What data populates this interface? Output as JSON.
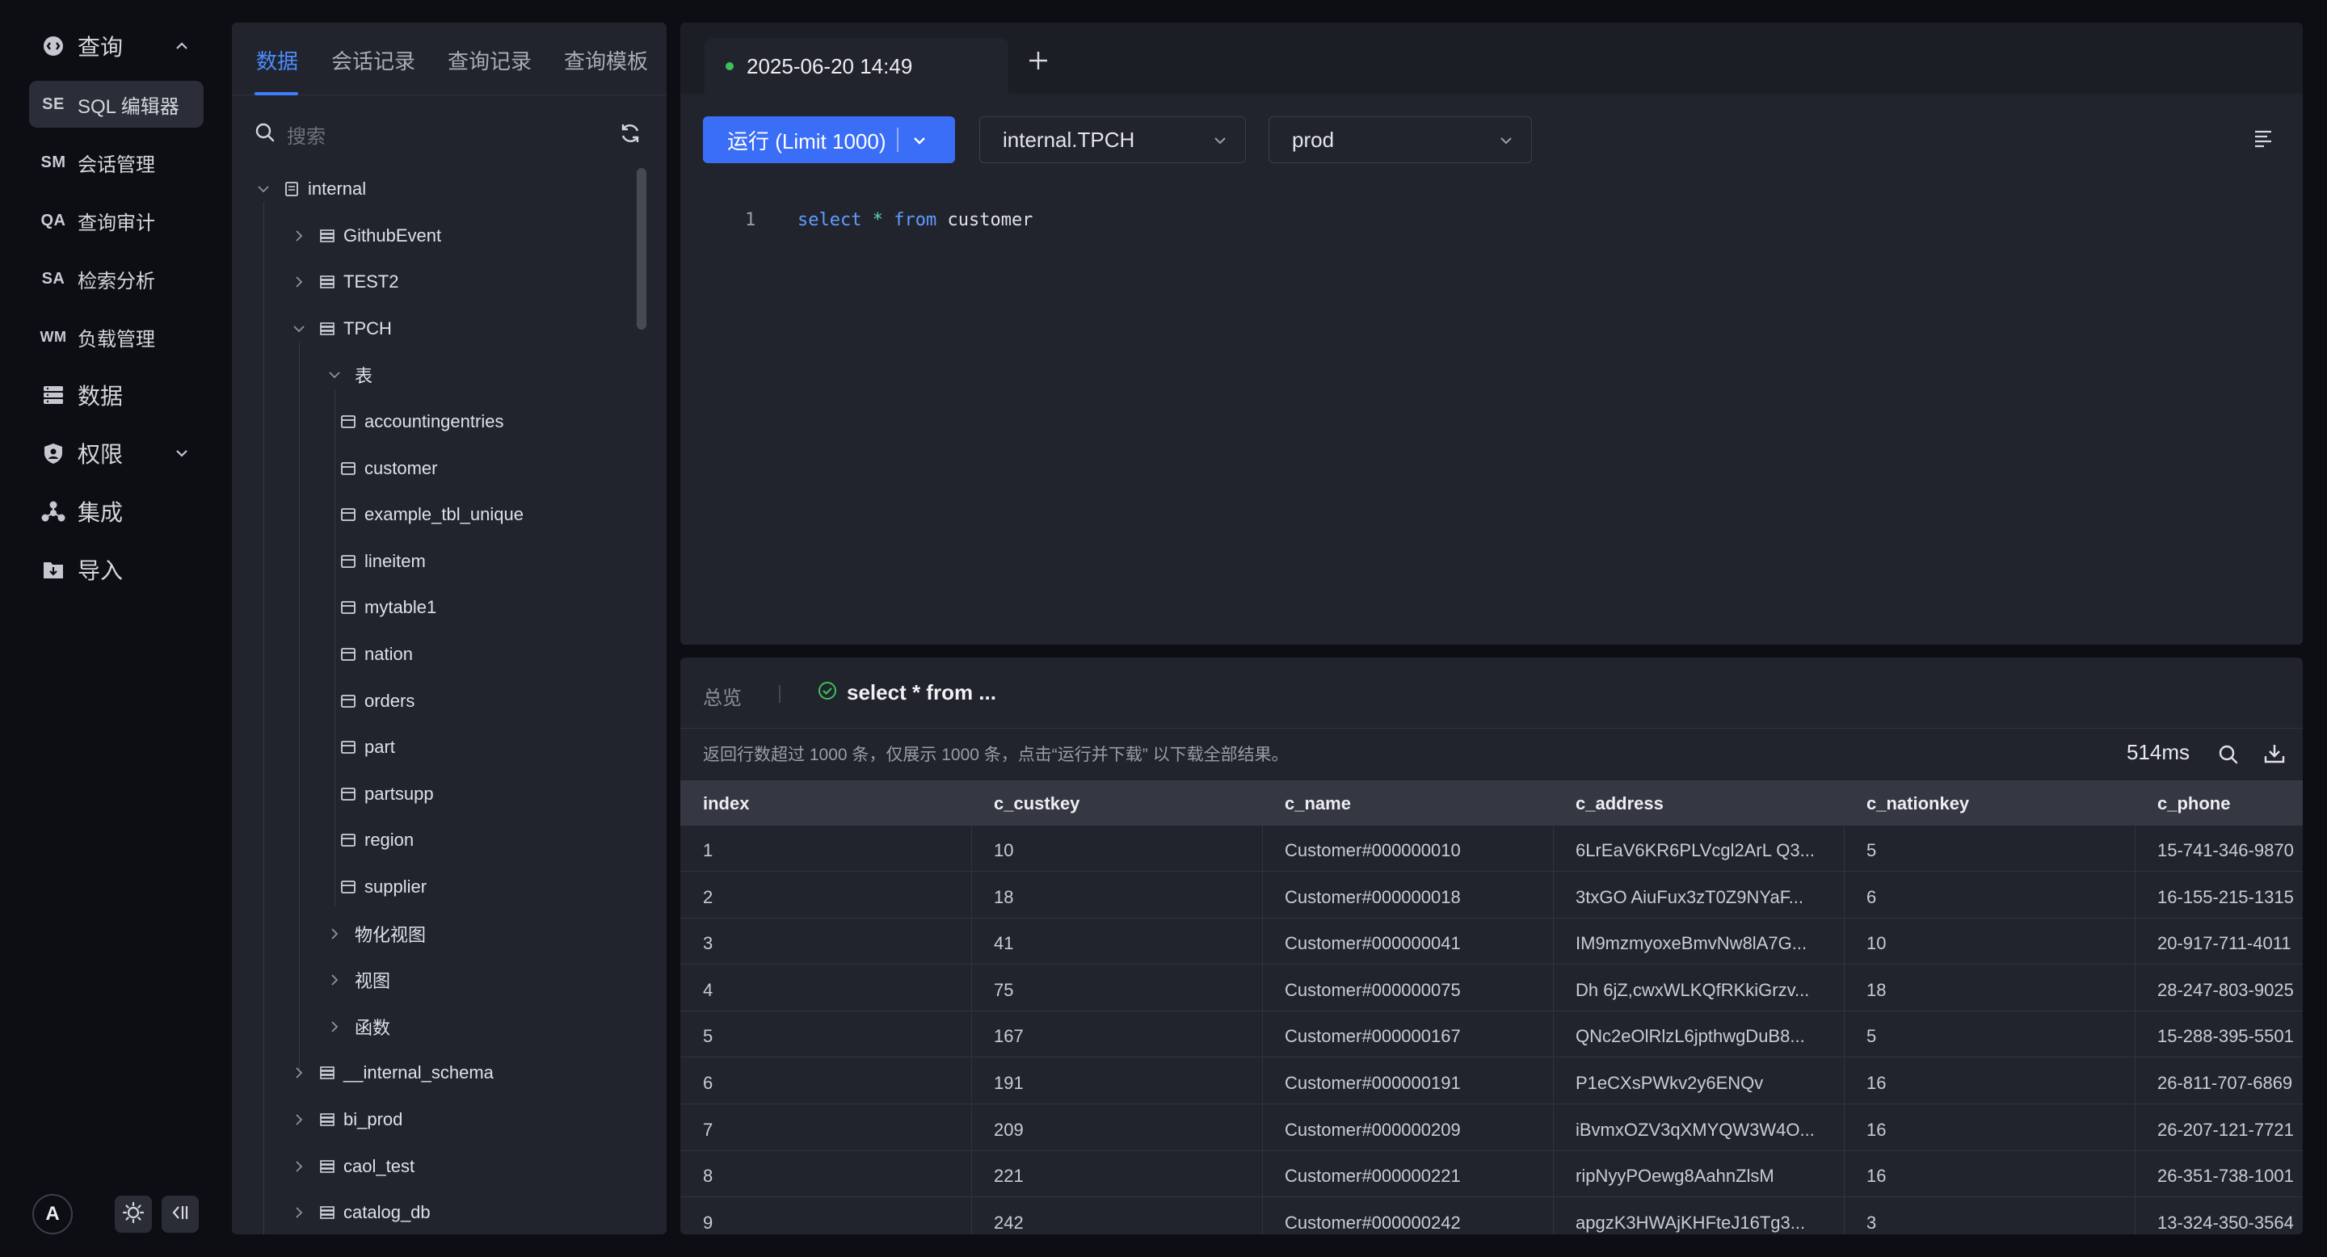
{
  "nav": {
    "query_label": "查询",
    "items": [
      {
        "abbr": "SE",
        "label": "SQL 编辑器"
      },
      {
        "abbr": "SM",
        "label": "会话管理"
      },
      {
        "abbr": "QA",
        "label": "查询审计"
      },
      {
        "abbr": "SA",
        "label": "检索分析"
      },
      {
        "abbr": "WM",
        "label": "负载管理"
      }
    ],
    "data_label": "数据",
    "permission_label": "权限",
    "integration_label": "集成",
    "import_label": "导入",
    "avatar_letter": "A"
  },
  "panel": {
    "tabs": [
      "数据",
      "会话记录",
      "查询记录",
      "查询模板"
    ],
    "search_placeholder": "搜索",
    "tree": {
      "root": "internal",
      "databases_top": [
        "GithubEvent",
        "TEST2"
      ],
      "open_db": "TPCH",
      "tables_folder": "表",
      "tables": [
        "accountingentries",
        "customer",
        "example_tbl_unique",
        "lineitem",
        "mytable1",
        "nation",
        "orders",
        "part",
        "partsupp",
        "region",
        "supplier"
      ],
      "folders": [
        "物化视图",
        "视图",
        "函数"
      ],
      "databases_bottom": [
        "__internal_schema",
        "bi_prod",
        "caol_test",
        "catalog_db"
      ]
    }
  },
  "editor": {
    "tab_title": "2025-06-20 14:49",
    "run_label": "运行 (Limit 1000)",
    "catalog": "internal.TPCH",
    "cluster": "prod",
    "line_number": "1",
    "code": {
      "kw1": "select",
      "star": "*",
      "kw2": "from",
      "table": "customer"
    }
  },
  "results": {
    "overview_label": "总览",
    "query_tab": "select * from ...",
    "notice": "返回行数超过 1000 条，仅展示 1000 条，点击“运行并下载” 以下载全部结果。",
    "elapsed": "514ms",
    "columns": [
      "index",
      "c_custkey",
      "c_name",
      "c_address",
      "c_nationkey",
      "c_phone"
    ],
    "rows": [
      [
        "1",
        "10",
        "Customer#000000010",
        "6LrEaV6KR6PLVcgl2ArL Q3...",
        "5",
        "15-741-346-9870"
      ],
      [
        "2",
        "18",
        "Customer#000000018",
        "3txGO AiuFux3zT0Z9NYaF...",
        "6",
        "16-155-215-1315"
      ],
      [
        "3",
        "41",
        "Customer#000000041",
        "IM9mzmyoxeBmvNw8lA7G...",
        "10",
        "20-917-711-4011"
      ],
      [
        "4",
        "75",
        "Customer#000000075",
        "Dh 6jZ,cwxWLKQfRKkiGrzv...",
        "18",
        "28-247-803-9025"
      ],
      [
        "5",
        "167",
        "Customer#000000167",
        "QNc2eOlRlzL6jpthwgDuB8...",
        "5",
        "15-288-395-5501"
      ],
      [
        "6",
        "191",
        "Customer#000000191",
        "P1eCXsPWkv2y6ENQv",
        "16",
        "26-811-707-6869"
      ],
      [
        "7",
        "209",
        "Customer#000000209",
        "iBvmxOZV3qXMYQW3W4O...",
        "16",
        "26-207-121-7721"
      ],
      [
        "8",
        "221",
        "Customer#000000221",
        "ripNyyPOewg8AahnZlsM",
        "16",
        "26-351-738-1001"
      ],
      [
        "9",
        "242",
        "Customer#000000242",
        "apgzK3HWAjKHFteJ16Tg3...",
        "3",
        "13-324-350-3564"
      ]
    ]
  },
  "colors": {
    "accent": "#3b6ef6",
    "success": "#3fbf5a"
  }
}
